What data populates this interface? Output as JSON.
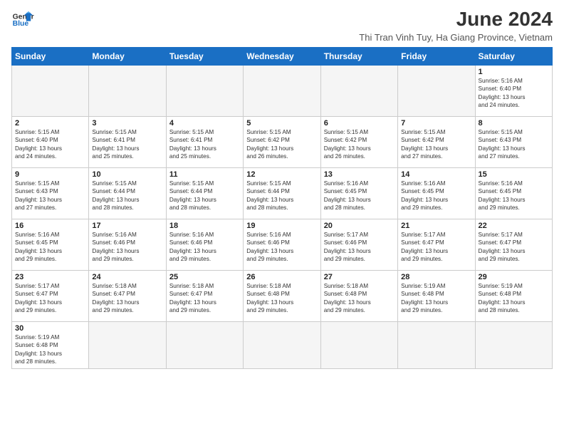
{
  "logo": {
    "line1": "General",
    "line2": "Blue"
  },
  "title": "June 2024",
  "subtitle": "Thi Tran Vinh Tuy, Ha Giang Province, Vietnam",
  "days_of_week": [
    "Sunday",
    "Monday",
    "Tuesday",
    "Wednesday",
    "Thursday",
    "Friday",
    "Saturday"
  ],
  "weeks": [
    [
      {
        "day": "",
        "info": ""
      },
      {
        "day": "",
        "info": ""
      },
      {
        "day": "",
        "info": ""
      },
      {
        "day": "",
        "info": ""
      },
      {
        "day": "",
        "info": ""
      },
      {
        "day": "",
        "info": ""
      },
      {
        "day": "1",
        "info": "Sunrise: 5:16 AM\nSunset: 6:40 PM\nDaylight: 13 hours\nand 24 minutes."
      }
    ],
    [
      {
        "day": "2",
        "info": "Sunrise: 5:15 AM\nSunset: 6:40 PM\nDaylight: 13 hours\nand 24 minutes."
      },
      {
        "day": "3",
        "info": "Sunrise: 5:15 AM\nSunset: 6:41 PM\nDaylight: 13 hours\nand 25 minutes."
      },
      {
        "day": "4",
        "info": "Sunrise: 5:15 AM\nSunset: 6:41 PM\nDaylight: 13 hours\nand 25 minutes."
      },
      {
        "day": "5",
        "info": "Sunrise: 5:15 AM\nSunset: 6:42 PM\nDaylight: 13 hours\nand 26 minutes."
      },
      {
        "day": "6",
        "info": "Sunrise: 5:15 AM\nSunset: 6:42 PM\nDaylight: 13 hours\nand 26 minutes."
      },
      {
        "day": "7",
        "info": "Sunrise: 5:15 AM\nSunset: 6:42 PM\nDaylight: 13 hours\nand 27 minutes."
      },
      {
        "day": "8",
        "info": "Sunrise: 5:15 AM\nSunset: 6:43 PM\nDaylight: 13 hours\nand 27 minutes."
      }
    ],
    [
      {
        "day": "9",
        "info": "Sunrise: 5:15 AM\nSunset: 6:43 PM\nDaylight: 13 hours\nand 27 minutes."
      },
      {
        "day": "10",
        "info": "Sunrise: 5:15 AM\nSunset: 6:44 PM\nDaylight: 13 hours\nand 28 minutes."
      },
      {
        "day": "11",
        "info": "Sunrise: 5:15 AM\nSunset: 6:44 PM\nDaylight: 13 hours\nand 28 minutes."
      },
      {
        "day": "12",
        "info": "Sunrise: 5:15 AM\nSunset: 6:44 PM\nDaylight: 13 hours\nand 28 minutes."
      },
      {
        "day": "13",
        "info": "Sunrise: 5:16 AM\nSunset: 6:45 PM\nDaylight: 13 hours\nand 28 minutes."
      },
      {
        "day": "14",
        "info": "Sunrise: 5:16 AM\nSunset: 6:45 PM\nDaylight: 13 hours\nand 29 minutes."
      },
      {
        "day": "15",
        "info": "Sunrise: 5:16 AM\nSunset: 6:45 PM\nDaylight: 13 hours\nand 29 minutes."
      }
    ],
    [
      {
        "day": "16",
        "info": "Sunrise: 5:16 AM\nSunset: 6:45 PM\nDaylight: 13 hours\nand 29 minutes."
      },
      {
        "day": "17",
        "info": "Sunrise: 5:16 AM\nSunset: 6:46 PM\nDaylight: 13 hours\nand 29 minutes."
      },
      {
        "day": "18",
        "info": "Sunrise: 5:16 AM\nSunset: 6:46 PM\nDaylight: 13 hours\nand 29 minutes."
      },
      {
        "day": "19",
        "info": "Sunrise: 5:16 AM\nSunset: 6:46 PM\nDaylight: 13 hours\nand 29 minutes."
      },
      {
        "day": "20",
        "info": "Sunrise: 5:17 AM\nSunset: 6:46 PM\nDaylight: 13 hours\nand 29 minutes."
      },
      {
        "day": "21",
        "info": "Sunrise: 5:17 AM\nSunset: 6:47 PM\nDaylight: 13 hours\nand 29 minutes."
      },
      {
        "day": "22",
        "info": "Sunrise: 5:17 AM\nSunset: 6:47 PM\nDaylight: 13 hours\nand 29 minutes."
      }
    ],
    [
      {
        "day": "23",
        "info": "Sunrise: 5:17 AM\nSunset: 6:47 PM\nDaylight: 13 hours\nand 29 minutes."
      },
      {
        "day": "24",
        "info": "Sunrise: 5:18 AM\nSunset: 6:47 PM\nDaylight: 13 hours\nand 29 minutes."
      },
      {
        "day": "25",
        "info": "Sunrise: 5:18 AM\nSunset: 6:47 PM\nDaylight: 13 hours\nand 29 minutes."
      },
      {
        "day": "26",
        "info": "Sunrise: 5:18 AM\nSunset: 6:48 PM\nDaylight: 13 hours\nand 29 minutes."
      },
      {
        "day": "27",
        "info": "Sunrise: 5:18 AM\nSunset: 6:48 PM\nDaylight: 13 hours\nand 29 minutes."
      },
      {
        "day": "28",
        "info": "Sunrise: 5:19 AM\nSunset: 6:48 PM\nDaylight: 13 hours\nand 29 minutes."
      },
      {
        "day": "29",
        "info": "Sunrise: 5:19 AM\nSunset: 6:48 PM\nDaylight: 13 hours\nand 28 minutes."
      }
    ],
    [
      {
        "day": "30",
        "info": "Sunrise: 5:19 AM\nSunset: 6:48 PM\nDaylight: 13 hours\nand 28 minutes."
      },
      {
        "day": "",
        "info": ""
      },
      {
        "day": "",
        "info": ""
      },
      {
        "day": "",
        "info": ""
      },
      {
        "day": "",
        "info": ""
      },
      {
        "day": "",
        "info": ""
      },
      {
        "day": "",
        "info": ""
      }
    ]
  ]
}
